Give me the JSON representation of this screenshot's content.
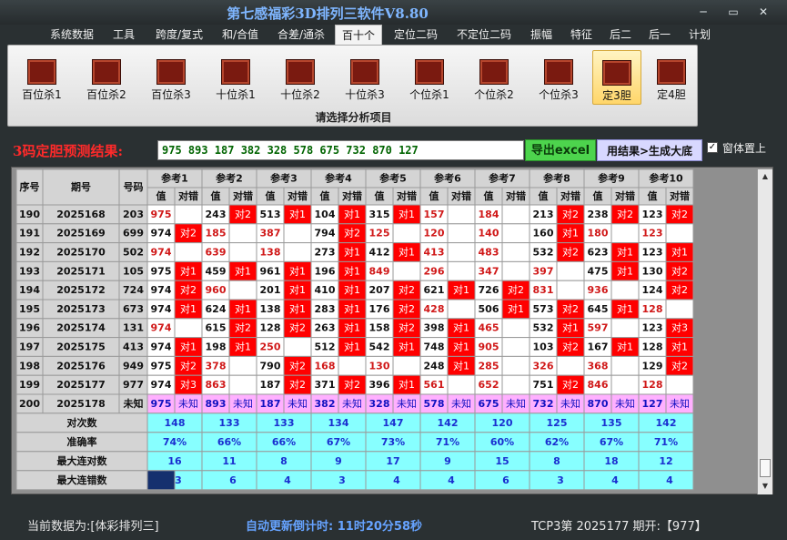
{
  "window": {
    "title": "第七感福彩3D排列三软件V8.80",
    "min": "─",
    "max": "▭",
    "close": "✕"
  },
  "menu": [
    {
      "label": "系统数据"
    },
    {
      "label": "工具"
    },
    {
      "label": "跨度/复式"
    },
    {
      "label": "和/合值"
    },
    {
      "label": "合差/通杀"
    },
    {
      "label": "百十个"
    },
    {
      "label": "定位二码"
    },
    {
      "label": "不定位二码"
    },
    {
      "label": "振幅"
    },
    {
      "label": "特征"
    },
    {
      "label": "后二"
    },
    {
      "label": "后一"
    },
    {
      "label": "计划"
    }
  ],
  "active_menu": "百十个",
  "ribbon": {
    "buttons": [
      {
        "label": "百位杀1"
      },
      {
        "label": "百位杀2"
      },
      {
        "label": "百位杀3"
      },
      {
        "label": "十位杀1"
      },
      {
        "label": "十位杀2"
      },
      {
        "label": "十位杀3"
      },
      {
        "label": "个位杀1"
      },
      {
        "label": "个位杀2"
      },
      {
        "label": "个位杀3"
      },
      {
        "label": "定3胆"
      },
      {
        "label": "定4胆"
      }
    ],
    "selected": "定3胆",
    "caption": "请选择分析项目"
  },
  "prediction": {
    "label": "3码定胆预测结果:",
    "value": "975 893 187 382 328 578 675 732 870 127",
    "export_button": "导出excel",
    "generate_button": "用结果>生成大底",
    "topmost_checkbox": "窗体置上",
    "topmost_checked": "✓"
  },
  "table": {
    "headers": {
      "seq": "序号",
      "issue": "期号",
      "number": "号码",
      "value": "值",
      "hit": "对错"
    },
    "groups": [
      "参考1",
      "参考2",
      "参考3",
      "参考4",
      "参考5",
      "参考6",
      "参考7",
      "参考8",
      "参考9",
      "参考10"
    ],
    "rows": [
      {
        "seq": "190",
        "issue": "2025168",
        "num": "203",
        "cells": [
          [
            "975",
            ""
          ],
          [
            "243",
            "对2"
          ],
          [
            "513",
            "对1"
          ],
          [
            "104",
            "对1"
          ],
          [
            "315",
            "对1"
          ],
          [
            "157",
            ""
          ],
          [
            "184",
            ""
          ],
          [
            "213",
            "对2"
          ],
          [
            "238",
            "对2"
          ],
          [
            "123",
            "对2"
          ]
        ]
      },
      {
        "seq": "191",
        "issue": "2025169",
        "num": "699",
        "cells": [
          [
            "974",
            "对2"
          ],
          [
            "185",
            ""
          ],
          [
            "387",
            ""
          ],
          [
            "794",
            "对2"
          ],
          [
            "125",
            ""
          ],
          [
            "120",
            ""
          ],
          [
            "140",
            ""
          ],
          [
            "160",
            "对1"
          ],
          [
            "180",
            ""
          ],
          [
            "123",
            ""
          ]
        ]
      },
      {
        "seq": "192",
        "issue": "2025170",
        "num": "502",
        "cells": [
          [
            "974",
            ""
          ],
          [
            "639",
            ""
          ],
          [
            "138",
            ""
          ],
          [
            "273",
            "对1"
          ],
          [
            "412",
            "对1"
          ],
          [
            "413",
            ""
          ],
          [
            "483",
            ""
          ],
          [
            "532",
            "对2"
          ],
          [
            "623",
            "对1"
          ],
          [
            "123",
            "对1"
          ]
        ]
      },
      {
        "seq": "193",
        "issue": "2025171",
        "num": "105",
        "cells": [
          [
            "975",
            "对1"
          ],
          [
            "459",
            "对1"
          ],
          [
            "961",
            "对1"
          ],
          [
            "196",
            "对1"
          ],
          [
            "849",
            ""
          ],
          [
            "296",
            ""
          ],
          [
            "347",
            ""
          ],
          [
            "397",
            ""
          ],
          [
            "475",
            "对1"
          ],
          [
            "130",
            "对2"
          ]
        ]
      },
      {
        "seq": "194",
        "issue": "2025172",
        "num": "724",
        "cells": [
          [
            "974",
            "对2"
          ],
          [
            "960",
            ""
          ],
          [
            "201",
            "对1"
          ],
          [
            "410",
            "对1"
          ],
          [
            "207",
            "对2"
          ],
          [
            "621",
            "对1"
          ],
          [
            "726",
            "对2"
          ],
          [
            "831",
            ""
          ],
          [
            "936",
            ""
          ],
          [
            "124",
            "对2"
          ]
        ]
      },
      {
        "seq": "195",
        "issue": "2025173",
        "num": "673",
        "cells": [
          [
            "974",
            "对1"
          ],
          [
            "624",
            "对1"
          ],
          [
            "138",
            "对1"
          ],
          [
            "283",
            "对1"
          ],
          [
            "176",
            "对2"
          ],
          [
            "428",
            ""
          ],
          [
            "506",
            "对1"
          ],
          [
            "573",
            "对2"
          ],
          [
            "645",
            "对1"
          ],
          [
            "128",
            ""
          ]
        ]
      },
      {
        "seq": "196",
        "issue": "2025174",
        "num": "131",
        "cells": [
          [
            "974",
            ""
          ],
          [
            "615",
            "对2"
          ],
          [
            "128",
            "对2"
          ],
          [
            "263",
            "对1"
          ],
          [
            "158",
            "对2"
          ],
          [
            "398",
            "对1"
          ],
          [
            "465",
            ""
          ],
          [
            "532",
            "对1"
          ],
          [
            "597",
            ""
          ],
          [
            "123",
            "对3"
          ]
        ]
      },
      {
        "seq": "197",
        "issue": "2025175",
        "num": "413",
        "cells": [
          [
            "974",
            "对1"
          ],
          [
            "198",
            "对1"
          ],
          [
            "250",
            ""
          ],
          [
            "512",
            "对1"
          ],
          [
            "542",
            "对1"
          ],
          [
            "748",
            "对1"
          ],
          [
            "905",
            ""
          ],
          [
            "103",
            "对2"
          ],
          [
            "167",
            "对1"
          ],
          [
            "128",
            "对1"
          ]
        ]
      },
      {
        "seq": "198",
        "issue": "2025176",
        "num": "949",
        "cells": [
          [
            "975",
            "对2"
          ],
          [
            "378",
            ""
          ],
          [
            "790",
            "对2"
          ],
          [
            "168",
            ""
          ],
          [
            "130",
            ""
          ],
          [
            "248",
            "对1"
          ],
          [
            "285",
            ""
          ],
          [
            "326",
            ""
          ],
          [
            "368",
            ""
          ],
          [
            "129",
            "对2"
          ]
        ]
      },
      {
        "seq": "199",
        "issue": "2025177",
        "num": "977",
        "cells": [
          [
            "974",
            "对3"
          ],
          [
            "863",
            ""
          ],
          [
            "187",
            "对2"
          ],
          [
            "371",
            "对2"
          ],
          [
            "396",
            "对1"
          ],
          [
            "561",
            ""
          ],
          [
            "652",
            ""
          ],
          [
            "751",
            "对2"
          ],
          [
            "846",
            ""
          ],
          [
            "128",
            ""
          ]
        ]
      },
      {
        "seq": "200",
        "issue": "2025178",
        "num": "未知",
        "cells": [
          [
            "975",
            "未知"
          ],
          [
            "893",
            "未知"
          ],
          [
            "187",
            "未知"
          ],
          [
            "382",
            "未知"
          ],
          [
            "328",
            "未知"
          ],
          [
            "578",
            "未知"
          ],
          [
            "675",
            "未知"
          ],
          [
            "732",
            "未知"
          ],
          [
            "870",
            "未知"
          ],
          [
            "127",
            "未知"
          ]
        ]
      }
    ],
    "summary": [
      {
        "label": "对次数",
        "values": [
          "148",
          "133",
          "133",
          "134",
          "147",
          "142",
          "120",
          "125",
          "135",
          "142"
        ]
      },
      {
        "label": "准确率",
        "values": [
          "74%",
          "66%",
          "66%",
          "67%",
          "73%",
          "71%",
          "60%",
          "62%",
          "67%",
          "71%"
        ]
      },
      {
        "label": "最大连对数",
        "values": [
          "16",
          "11",
          "8",
          "9",
          "17",
          "9",
          "15",
          "8",
          "18",
          "12"
        ]
      },
      {
        "label": "最大连错数",
        "values": [
          "3",
          "6",
          "4",
          "3",
          "4",
          "4",
          "6",
          "3",
          "4",
          "4"
        ]
      }
    ]
  },
  "scrollbar": {
    "up": "▲",
    "down": "▼"
  },
  "status": {
    "source": "当前数据为:[体彩排列三]",
    "countdown": "自动更新倒计时: 11时20分58秒",
    "issue": "TCP3第 2025177 期开:【977】"
  },
  "colors": {
    "hit_red": "#ff0000",
    "miss_text": "#d01818",
    "header_gray": "#d4d4d4",
    "summary_cyan": "#87ffff",
    "unknown_pink": "#ffb0ff",
    "pred_green": "#006400",
    "title_blue": "#7fb6ff"
  }
}
